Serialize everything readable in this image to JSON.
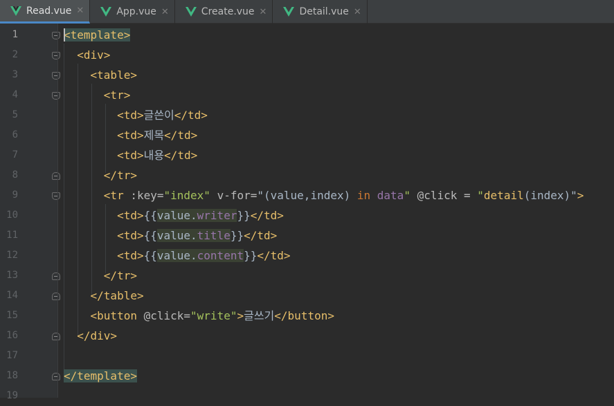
{
  "tabs": [
    {
      "label": "Read.vue",
      "active": true
    },
    {
      "label": "App.vue",
      "active": false
    },
    {
      "label": "Create.vue",
      "active": false
    },
    {
      "label": "Detail.vue",
      "active": false
    }
  ],
  "icons": {
    "tab_file": "vue-file-icon",
    "tab_close": "close-icon",
    "fold": "fold-marker-icon"
  },
  "colors": {
    "vue": "#41b883",
    "tag": "#e8bf6a",
    "string": "#a5c25c",
    "keyword": "#cc7832",
    "variable": "#9876aa",
    "text": "#a9b7c6"
  },
  "line_numbers": [
    "1",
    "2",
    "3",
    "4",
    "5",
    "6",
    "7",
    "8",
    "9",
    "10",
    "11",
    "12",
    "13",
    "14",
    "15",
    "16",
    "17",
    "18",
    "19"
  ],
  "code": {
    "l1": {
      "open": "<template>"
    },
    "l2": {
      "tag": "<div>"
    },
    "l3": {
      "tag": "<table>"
    },
    "l4": {
      "tag": "<tr>"
    },
    "l5": {
      "open": "<td>",
      "text": "글쓴이",
      "close": "</td>"
    },
    "l6": {
      "open": "<td>",
      "text": "제목",
      "close": "</td>"
    },
    "l7": {
      "open": "<td>",
      "text": "내용",
      "close": "</td>"
    },
    "l8": {
      "tag": "</tr>"
    },
    "l9": {
      "t1": "<tr ",
      "a1": ":key=",
      "s1": "\"index\"",
      "a2": " v-for=",
      "s2a": "\"(value,index) ",
      "k1": "in",
      "s2b": " ",
      "v1": "data",
      "s2c": "\"",
      "a3": " @click = ",
      "s3a": "\"",
      "s3b": "detail",
      "s3c": "(index)\"",
      "t2": ">"
    },
    "l10": {
      "open": "<td>",
      "m1": "{{",
      "obj": "value.",
      "prop": "writer",
      "m2": "}}",
      "close": "</td>"
    },
    "l11": {
      "open": "<td>",
      "m1": "{{",
      "obj": "value.",
      "prop": "title",
      "m2": "}}",
      "close": "</td>"
    },
    "l12": {
      "open": "<td>",
      "m1": "{{",
      "obj": "value.",
      "prop": "content",
      "m2": "}}",
      "close": "</td>"
    },
    "l13": {
      "tag": "</tr>"
    },
    "l14": {
      "tag": "</table>"
    },
    "l15": {
      "t1": "<button ",
      "a1": "@click=",
      "s1": "\"write\"",
      "t2": ">",
      "text": "글쓰기",
      "t3": "</button>"
    },
    "l16": {
      "tag": "</div>"
    },
    "l18": {
      "close": "</template>"
    }
  }
}
